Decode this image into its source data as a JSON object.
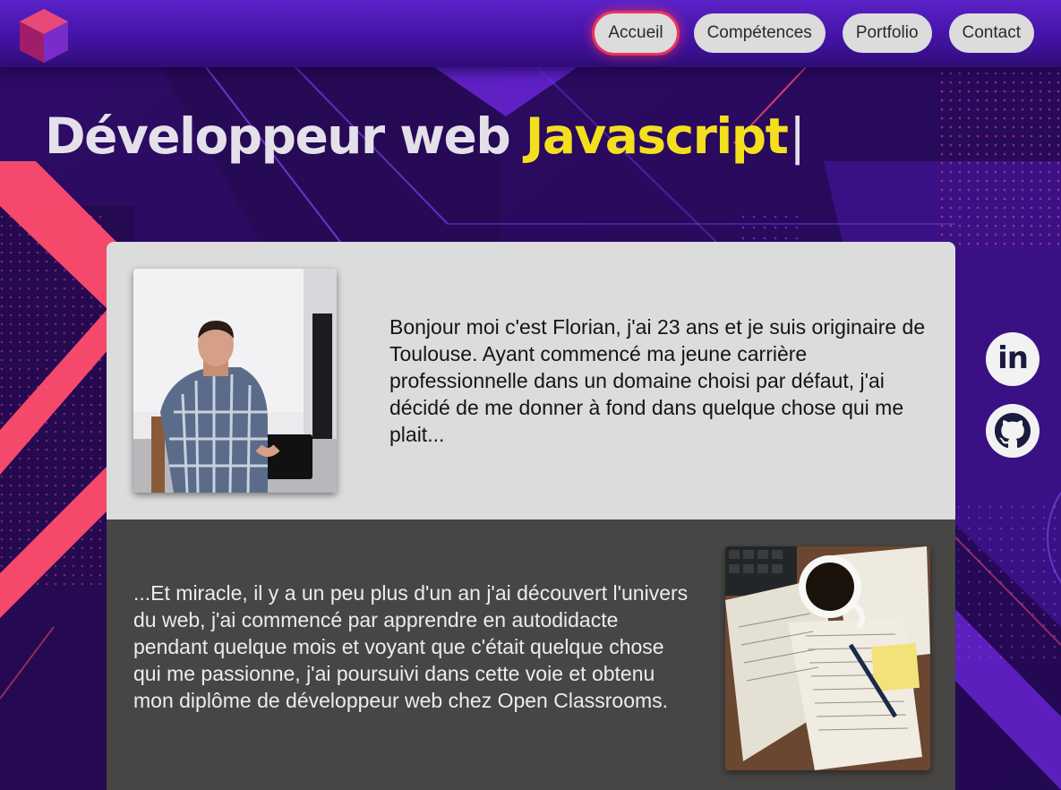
{
  "nav": {
    "items": [
      {
        "label": "Accueil",
        "active": true
      },
      {
        "label": "Compétences",
        "active": false
      },
      {
        "label": "Portfolio",
        "active": false
      },
      {
        "label": "Contact",
        "active": false
      }
    ]
  },
  "hero": {
    "title_prefix": "Développeur web ",
    "title_highlight": "Javascript",
    "cursor": "|"
  },
  "about": {
    "intro": "Bonjour moi c'est Florian, j'ai 23 ans et je suis originaire de Toulouse. Ayant commencé ma jeune carrière professionnelle dans un domaine choisi par défaut, j'ai décidé de me donner à fond dans quelque chose qui me plait...",
    "story": "...Et miracle, il y a un peu plus d'un an j'ai découvert l'univers du web, j'ai commencé par apprendre en autodidacte pendant quelque mois et voyant que c'était quelque chose qui me passionne, j'ai poursuivi dans cette voie et obtenu mon diplôme de développeur web chez Open Classrooms."
  },
  "social": {
    "linkedin_glyph": "in",
    "icons": [
      "linkedin-icon",
      "github-icon"
    ]
  },
  "colors": {
    "background": "#2a0b5c",
    "header": "#4413a6",
    "accent_yellow": "#f4df1e",
    "accent_pink": "#ff4d6d",
    "card_light": "#dcdcdc",
    "card_dark": "#474645"
  }
}
